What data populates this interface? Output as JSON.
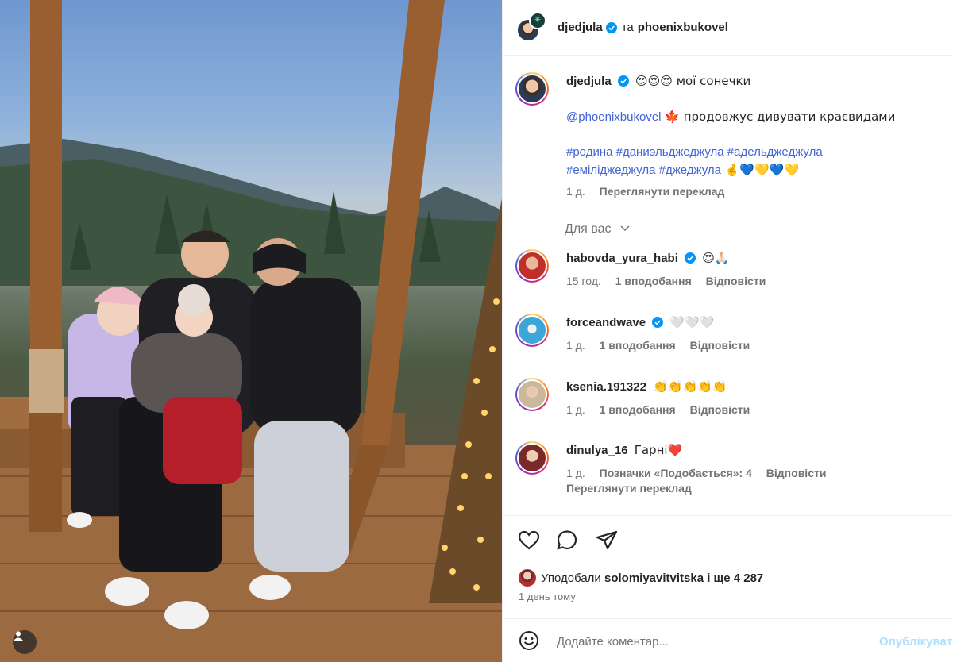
{
  "header": {
    "author": "djedjula",
    "joiner": "та",
    "coauthor": "phoenixbukovel"
  },
  "caption": {
    "author": "djedjula",
    "line1_text": "😍😍😍 мої сонечки",
    "mention": "@phoenixbukovel",
    "line2_text": " 🍁 продовжує дивувати краєвидами",
    "hashtags_line1": "#родина #даниэльджеджула #адельджеджула",
    "hashtags_line2": "#емілiджеджула #джеджула",
    "hashtags_line2_emoji": " 🤞💙💛💙💛",
    "time": "1 д.",
    "translate": "Переглянути переклад"
  },
  "for_you_label": "Для вас",
  "comments": [
    {
      "user": "habovda_yura_habi",
      "verified": true,
      "text": "😍🙏🏻",
      "time": "15 год.",
      "likes": "1 вподобання",
      "reply": "Відповісти",
      "avatar_color": "#c0302b"
    },
    {
      "user": "forceandwave",
      "verified": true,
      "text": "🤍🤍🤍",
      "time": "1 д.",
      "likes": "1 вподобання",
      "reply": "Відповісти",
      "avatar_color": "#3aa6d9"
    },
    {
      "user": "ksenia.191322",
      "verified": false,
      "text": "👏👏👏👏👏",
      "time": "1 д.",
      "likes": "1 вподобання",
      "reply": "Відповісти",
      "avatar_color": "#c9b89a"
    },
    {
      "user": "dinulya_16",
      "verified": false,
      "text": "Гарні❤️",
      "time": "1 д.",
      "likes": "Позначки «Подобається»: 4",
      "reply": "Відповісти",
      "translate": "Переглянути переклад",
      "avatar_color": "#7a2a2a"
    }
  ],
  "likes_summary": {
    "prefix": "Уподобали",
    "user": "solomiyavitvitska",
    "suffix": "і ще 4 287"
  },
  "posted_ago": "1 день тому",
  "comment_input": {
    "placeholder": "Додайте коментар...",
    "post_label": "Опублікувати"
  },
  "colors": {
    "link": "#4264d4",
    "verified": "#0095f6",
    "muted": "#737373"
  }
}
